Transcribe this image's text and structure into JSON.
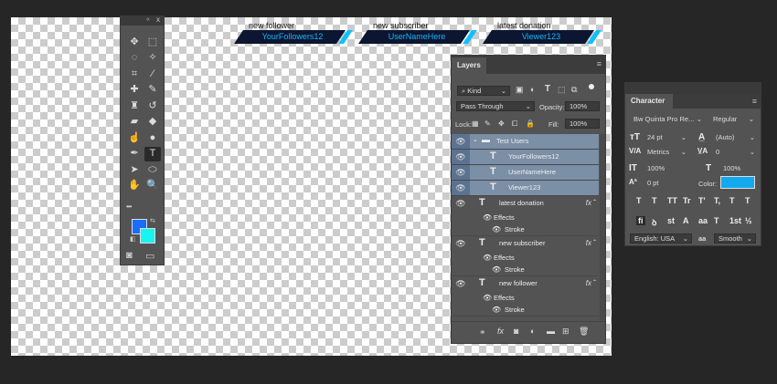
{
  "colors": {
    "workspace_bg": "#262626",
    "panel_bg": "#535353",
    "selection_blue": "#7b8fa6",
    "banner_dark": "#0c1630",
    "banner_accent": "#11bfff",
    "foreground_swatch": "#1a6dff",
    "background_swatch": "#17f5f0",
    "char_color_swatch": "#13a9ef"
  },
  "canvas": {
    "banners": [
      {
        "label": "new follower",
        "value": "YourFollowers12"
      },
      {
        "label": "new subscriber",
        "value": "UserNameHere"
      },
      {
        "label": "latest donation",
        "value": "Viewer123"
      }
    ]
  },
  "toolbar": {
    "collapse_icon": "double-chevron-icon",
    "close_icon": "x",
    "tools": [
      {
        "name": "move-tool-icon",
        "glyph": "✥"
      },
      {
        "name": "marquee-tool-icon",
        "glyph": "⬚"
      },
      {
        "name": "lasso-tool-icon",
        "glyph": "◌"
      },
      {
        "name": "magic-wand-tool-icon",
        "glyph": "✧"
      },
      {
        "name": "crop-tool-icon",
        "glyph": "⌗"
      },
      {
        "name": "eyedropper-tool-icon",
        "glyph": "⁄"
      },
      {
        "name": "healing-brush-tool-icon",
        "glyph": "✚"
      },
      {
        "name": "brush-tool-icon",
        "glyph": "✎"
      },
      {
        "name": "stamp-tool-icon",
        "glyph": "♜"
      },
      {
        "name": "history-brush-tool-icon",
        "glyph": "↺"
      },
      {
        "name": "eraser-tool-icon",
        "glyph": "▰"
      },
      {
        "name": "paint-bucket-tool-icon",
        "glyph": "◆"
      },
      {
        "name": "smudge-tool-icon",
        "glyph": "☝"
      },
      {
        "name": "dodge-tool-icon",
        "glyph": "●"
      },
      {
        "name": "pen-tool-icon",
        "glyph": "✒"
      },
      {
        "name": "type-tool-icon",
        "glyph": "T"
      },
      {
        "name": "path-selection-tool-icon",
        "glyph": "➤"
      },
      {
        "name": "shape-tool-icon",
        "glyph": "⬭"
      },
      {
        "name": "hand-tool-icon",
        "glyph": "✋"
      },
      {
        "name": "zoom-tool-icon",
        "glyph": "🔍"
      }
    ],
    "more_glyph": "•••",
    "quick_mask_icon": "◙",
    "screen_mode_icon": "▭"
  },
  "layers_panel": {
    "tab_label": "Layers",
    "filter_label": "Kind",
    "blend_mode": "Pass Through",
    "opacity_label": "Opacity:",
    "opacity_value": "100%",
    "lock_label": "Lock:",
    "fill_label": "Fill:",
    "fill_value": "100%",
    "layers": [
      {
        "name": "Test Users",
        "type": "group",
        "selected": true
      },
      {
        "name": "YourFollowers12",
        "type": "text",
        "selected": true
      },
      {
        "name": "UserNameHere",
        "type": "text",
        "selected": true
      },
      {
        "name": "Viewer123",
        "type": "text",
        "selected": true
      },
      {
        "name": "latest donation",
        "type": "text",
        "fx": true
      },
      {
        "name": "Effects",
        "type": "effects"
      },
      {
        "name": "Stroke",
        "type": "stroke"
      },
      {
        "name": "new subscriber",
        "type": "text",
        "fx": true
      },
      {
        "name": "Effects",
        "type": "effects"
      },
      {
        "name": "Stroke",
        "type": "stroke"
      },
      {
        "name": "new follower",
        "type": "text",
        "fx": true
      },
      {
        "name": "Effects",
        "type": "effects"
      },
      {
        "name": "Stroke",
        "type": "stroke"
      }
    ],
    "footer_fx": "fx"
  },
  "character_panel": {
    "tab_label": "Character",
    "font_family": "Bw Quinta Pro Re...",
    "font_style": "Regular",
    "font_size": "24 pt",
    "leading": "(Auto)",
    "kerning": "Metrics",
    "tracking": "0",
    "vertical_scale": "100%",
    "horizontal_scale": "100%",
    "baseline_shift": "0 pt",
    "color_label": "Color:",
    "style_buttons": [
      "T",
      "T",
      "TT",
      "Tr",
      "T'",
      "T,",
      "T",
      "T"
    ],
    "opentype_buttons": [
      "fi",
      "ꝺ",
      "st",
      "A",
      "aa",
      "T",
      "1st",
      "½"
    ],
    "language": "English: USA",
    "aa_label": "aa",
    "antialias": "Smooth"
  }
}
